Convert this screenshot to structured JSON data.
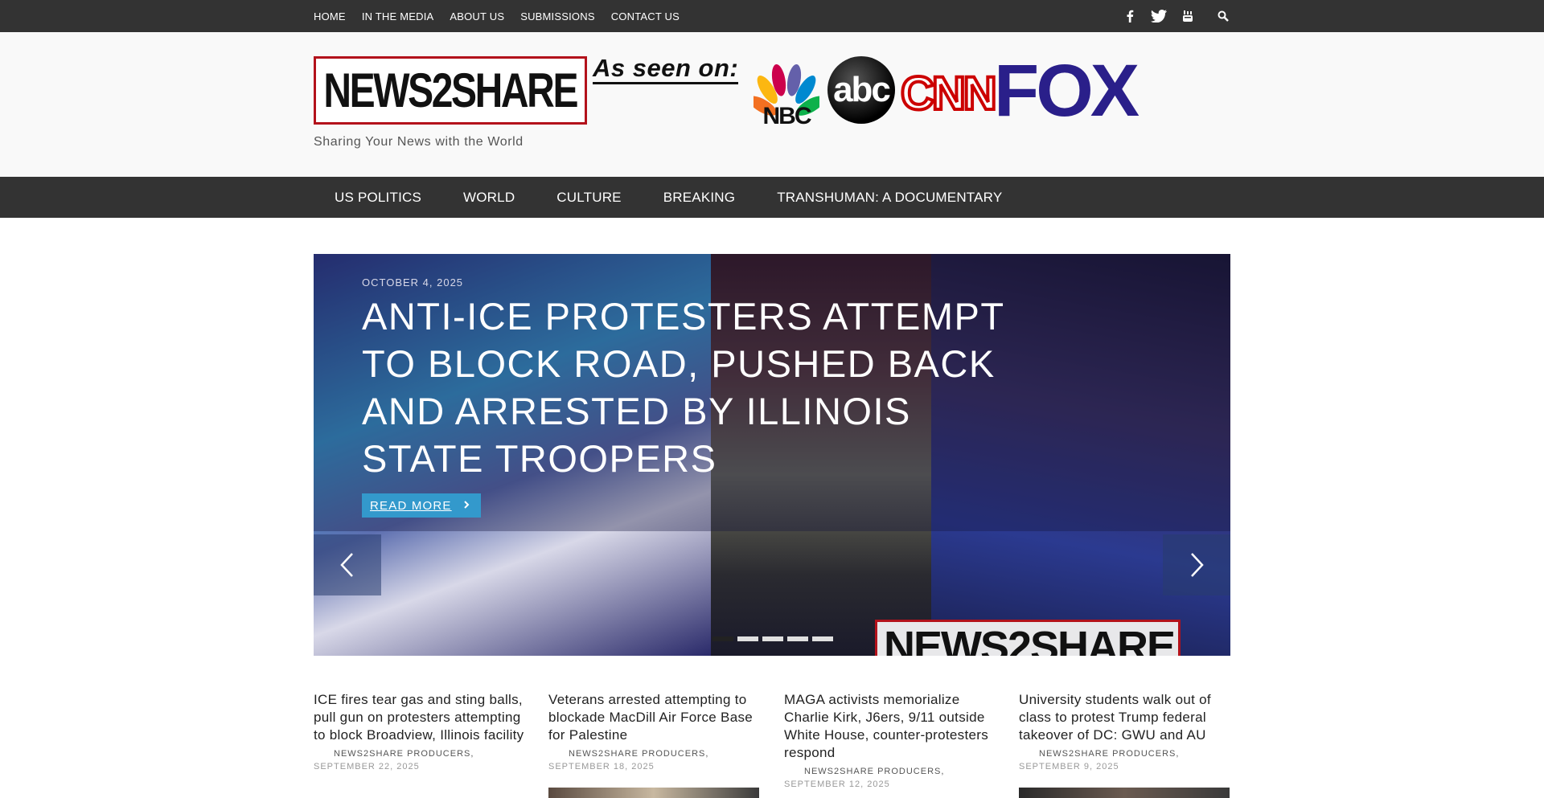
{
  "top_nav": [
    "HOME",
    "IN THE MEDIA",
    "ABOUT US",
    "SUBMISSIONS",
    "CONTACT US"
  ],
  "social_icons": [
    "facebook-icon",
    "twitter-icon",
    "youtube-icon",
    "search-icon"
  ],
  "header": {
    "logo_text": "NEWS2SHARE",
    "tagline": "Sharing Your News with the World",
    "as_seen_on": "As seen on:",
    "media_logos": [
      "NBC",
      "abc",
      "CNN",
      "FOX"
    ],
    "watermark": "NEWS2SHARE"
  },
  "main_nav": [
    "US POLITICS",
    "WORLD",
    "CULTURE",
    "BREAKING",
    "TRANSHUMAN: A DOCUMENTARY"
  ],
  "slider": {
    "date": "OCTOBER 4, 2025",
    "title": "ANTI-ICE PROTESTERS ATTEMPT TO BLOCK ROAD, PUSHED BACK AND ARRESTED BY ILLINOIS STATE TROOPERS",
    "read_more": "READ MORE",
    "dot_count": 5,
    "active_dot": 0
  },
  "posts": [
    {
      "title": "ICE fires tear gas and sting balls, pull gun on protesters attempting to block Broadview, Illinois facility",
      "author": "NEWS2SHARE PRODUCERS,",
      "date": "SEPTEMBER 22, 2025"
    },
    {
      "title": "Veterans arrested attempting to blockade MacDill Air Force Base for Palestine",
      "author": "NEWS2SHARE PRODUCERS,",
      "date": "SEPTEMBER 18, 2025"
    },
    {
      "title": "MAGA activists memorialize Charlie Kirk, J6ers, 9/11 outside White House, counter-protesters respond",
      "author": "NEWS2SHARE PRODUCERS,",
      "date": "SEPTEMBER 12, 2025"
    },
    {
      "title": "University students walk out of class to protest Trump federal takeover of DC: GWU and AU",
      "author": "NEWS2SHARE PRODUCERS,",
      "date": "SEPTEMBER 9, 2025"
    }
  ],
  "colors": {
    "bar": "#333333",
    "accent": "#3399cc",
    "logo_border": "#b3121b",
    "fox": "#2a1f8a"
  }
}
